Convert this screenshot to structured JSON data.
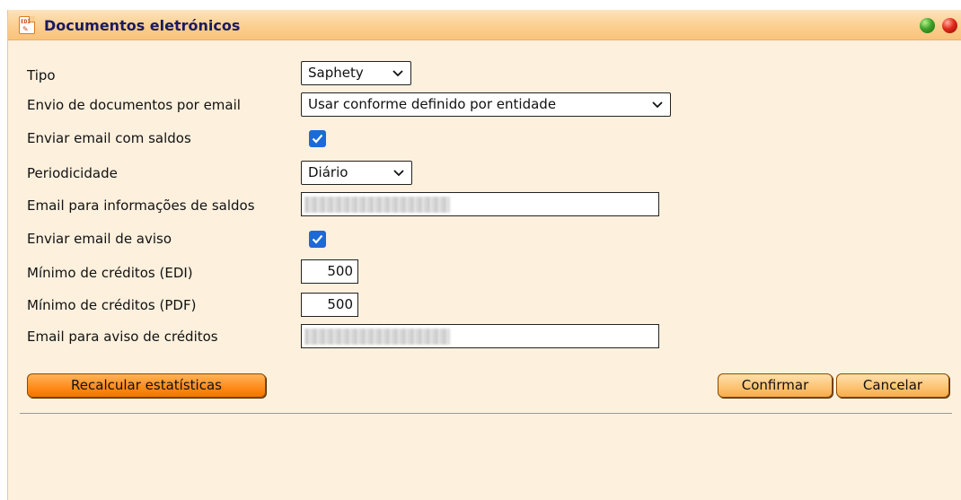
{
  "window": {
    "title": "Documentos eletrónicos",
    "icon": "edi-document-icon"
  },
  "form": {
    "tipo": {
      "label": "Tipo",
      "value": "Saphety"
    },
    "envio": {
      "label": "Envio de documentos por email",
      "value": "Usar conforme definido por entidade"
    },
    "enviar_saldos": {
      "label": "Enviar email com saldos",
      "checked": true
    },
    "periodicidade": {
      "label": "Periodicidade",
      "value": "Diário"
    },
    "email_saldos": {
      "label": "Email para informações de saldos",
      "value": ""
    },
    "enviar_aviso": {
      "label": "Enviar email de aviso",
      "checked": true
    },
    "min_edi": {
      "label": "Mínimo de créditos (EDI)",
      "value": "500"
    },
    "min_pdf": {
      "label": "Mínimo de créditos (PDF)",
      "value": "500"
    },
    "email_aviso": {
      "label": "Email para aviso de créditos",
      "value": ""
    }
  },
  "buttons": {
    "recalcular": "Recalcular estatísticas",
    "confirmar": "Confirmar",
    "cancelar": "Cancelar"
  },
  "colors": {
    "accent": "#ff8a1a",
    "title_text": "#1b1a60",
    "checkbox": "#1b6ad8"
  }
}
